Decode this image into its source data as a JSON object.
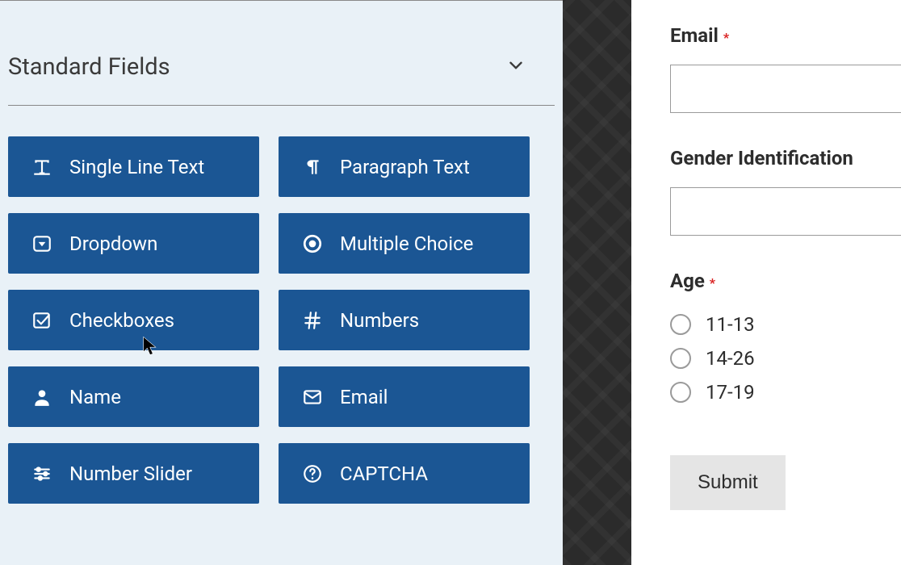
{
  "panel": {
    "section_title": "Standard Fields",
    "fields": {
      "single_line_text": "Single Line Text",
      "paragraph_text": "Paragraph Text",
      "dropdown": "Dropdown",
      "multiple_choice": "Multiple Choice",
      "checkboxes": "Checkboxes",
      "numbers": "Numbers",
      "name": "Name",
      "email": "Email",
      "number_slider": "Number Slider",
      "captcha": "CAPTCHA"
    }
  },
  "preview": {
    "email_label": "Email",
    "email_required": "*",
    "gender_label": "Gender Identification",
    "age_label": "Age",
    "age_required": "*",
    "age_options": {
      "opt0": "11-13",
      "opt1": "14-26",
      "opt2": "17-19"
    },
    "submit_label": "Submit"
  }
}
